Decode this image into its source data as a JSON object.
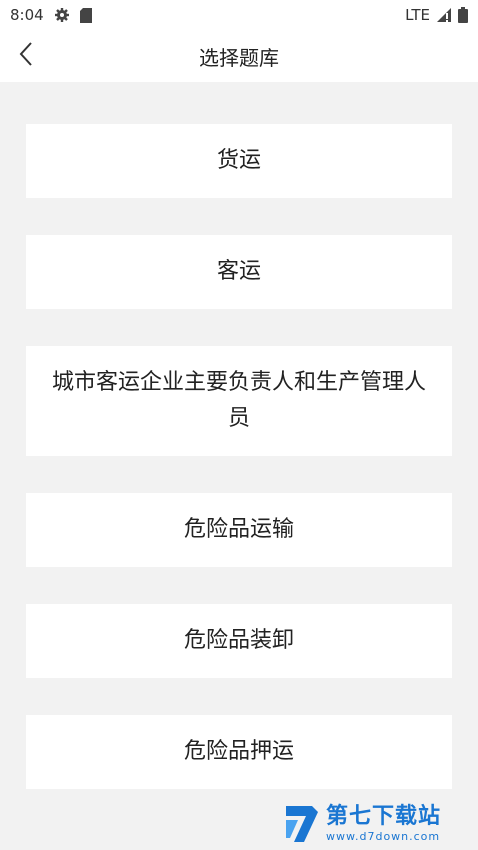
{
  "status_bar": {
    "time": "8:04",
    "network": "LTE",
    "icons": [
      "settings-icon",
      "sd-card-icon",
      "signal-icon",
      "battery-icon"
    ]
  },
  "header": {
    "title": "选择题库",
    "back_icon": "chevron-left-icon"
  },
  "categories": [
    {
      "label": "货运"
    },
    {
      "label": "客运"
    },
    {
      "label": "城市客运企业主要负责人和生产管理人员"
    },
    {
      "label": "危险品运输"
    },
    {
      "label": "危险品装卸"
    },
    {
      "label": "危险品押运"
    }
  ],
  "watermark": {
    "name": "第七下载站",
    "url": "www.d7down.com"
  },
  "colors": {
    "background": "#f2f2f2",
    "card": "#ffffff",
    "watermark": "#1a76d2"
  }
}
